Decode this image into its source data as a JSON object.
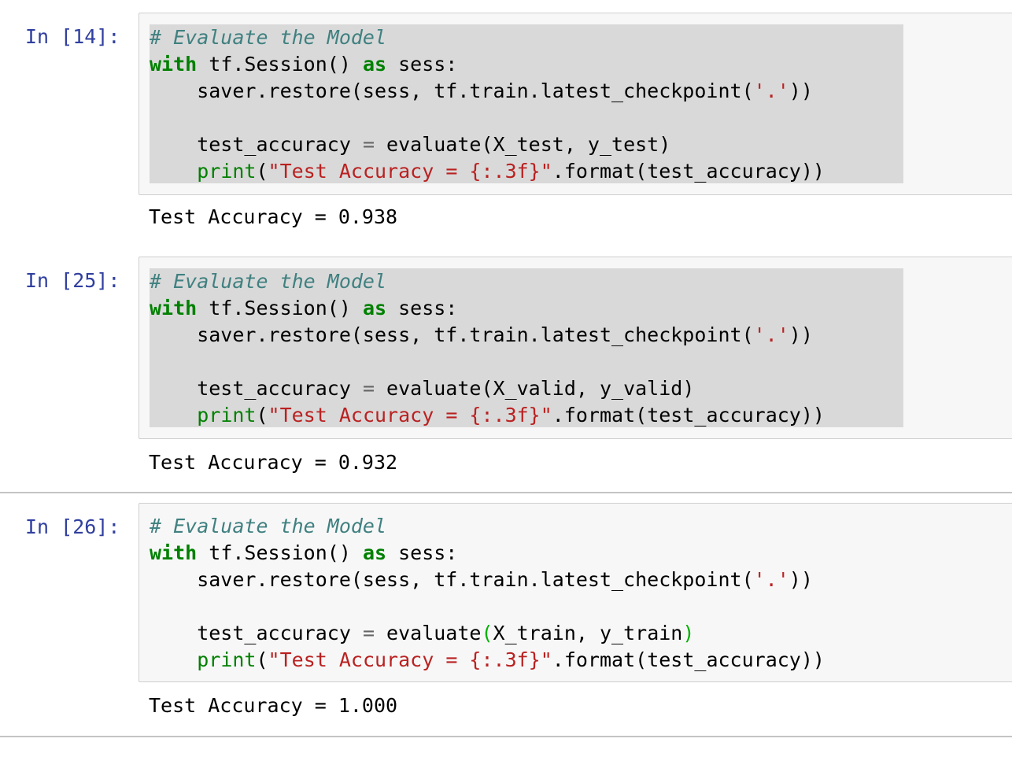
{
  "cells": [
    {
      "prompt": "In [14]:",
      "code": {
        "comment": "# Evaluate the Model",
        "with_kw": "with",
        "session_expr": " tf.Session() ",
        "as_kw": "as",
        "sess_tail": " sess:",
        "restore_pre": "    saver.restore(sess, tf.train.latest_checkpoint(",
        "restore_str": "'.'",
        "restore_post": "))",
        "blank": " ",
        "eval_pre": "    test_accuracy ",
        "eval_eq": "=",
        "eval_call": " evaluate(X_test, y_test)",
        "print_indent": "    ",
        "print_fn": "print",
        "print_open": "(",
        "print_str": "\"Test Accuracy = {:.3f}\"",
        "print_tail": ".format(test_accuracy))"
      },
      "output": "Test Accuracy = 0.938"
    },
    {
      "prompt": "In [25]:",
      "code": {
        "comment": "# Evaluate the Model",
        "with_kw": "with",
        "session_expr": " tf.Session() ",
        "as_kw": "as",
        "sess_tail": " sess:",
        "restore_pre": "    saver.restore(sess, tf.train.latest_checkpoint(",
        "restore_str": "'.'",
        "restore_post": "))",
        "blank": " ",
        "eval_pre": "    test_accuracy ",
        "eval_eq": "=",
        "eval_call": " evaluate(X_valid, y_valid)",
        "print_indent": "    ",
        "print_fn": "print",
        "print_open": "(",
        "print_str": "\"Test Accuracy = {:.3f}\"",
        "print_tail": ".format(test_accuracy))"
      },
      "output": "Test Accuracy = 0.932"
    },
    {
      "prompt": "In [26]:",
      "code": {
        "comment": "# Evaluate the Model",
        "with_kw": "with",
        "session_expr": " tf.Session() ",
        "as_kw": "as",
        "sess_tail": " sess:",
        "restore_pre": "    saver.restore(sess, tf.train.latest_checkpoint(",
        "restore_str": "'.'",
        "restore_post": "))",
        "blank": " ",
        "eval_pre": "    test_accuracy ",
        "eval_eq": "=",
        "eval_call_name": " evaluate",
        "eval_open": "(",
        "eval_args": "X_train, y_train",
        "eval_close": ")",
        "print_indent": "    ",
        "print_fn": "print",
        "print_open": "(",
        "print_str": "\"Test Accuracy = {:.3f}\"",
        "print_tail": ".format(test_accuracy))"
      },
      "output": "Test Accuracy = 1.000"
    }
  ],
  "colors": {
    "prompt": "#303f9f",
    "keyword": "#008000",
    "string": "#ba2121",
    "comment": "#408080",
    "selection": "#d9d9d9",
    "bracket_match": "#00b000",
    "cell_border": "#cfcfcf",
    "cell_bg": "#f7f7f7"
  }
}
